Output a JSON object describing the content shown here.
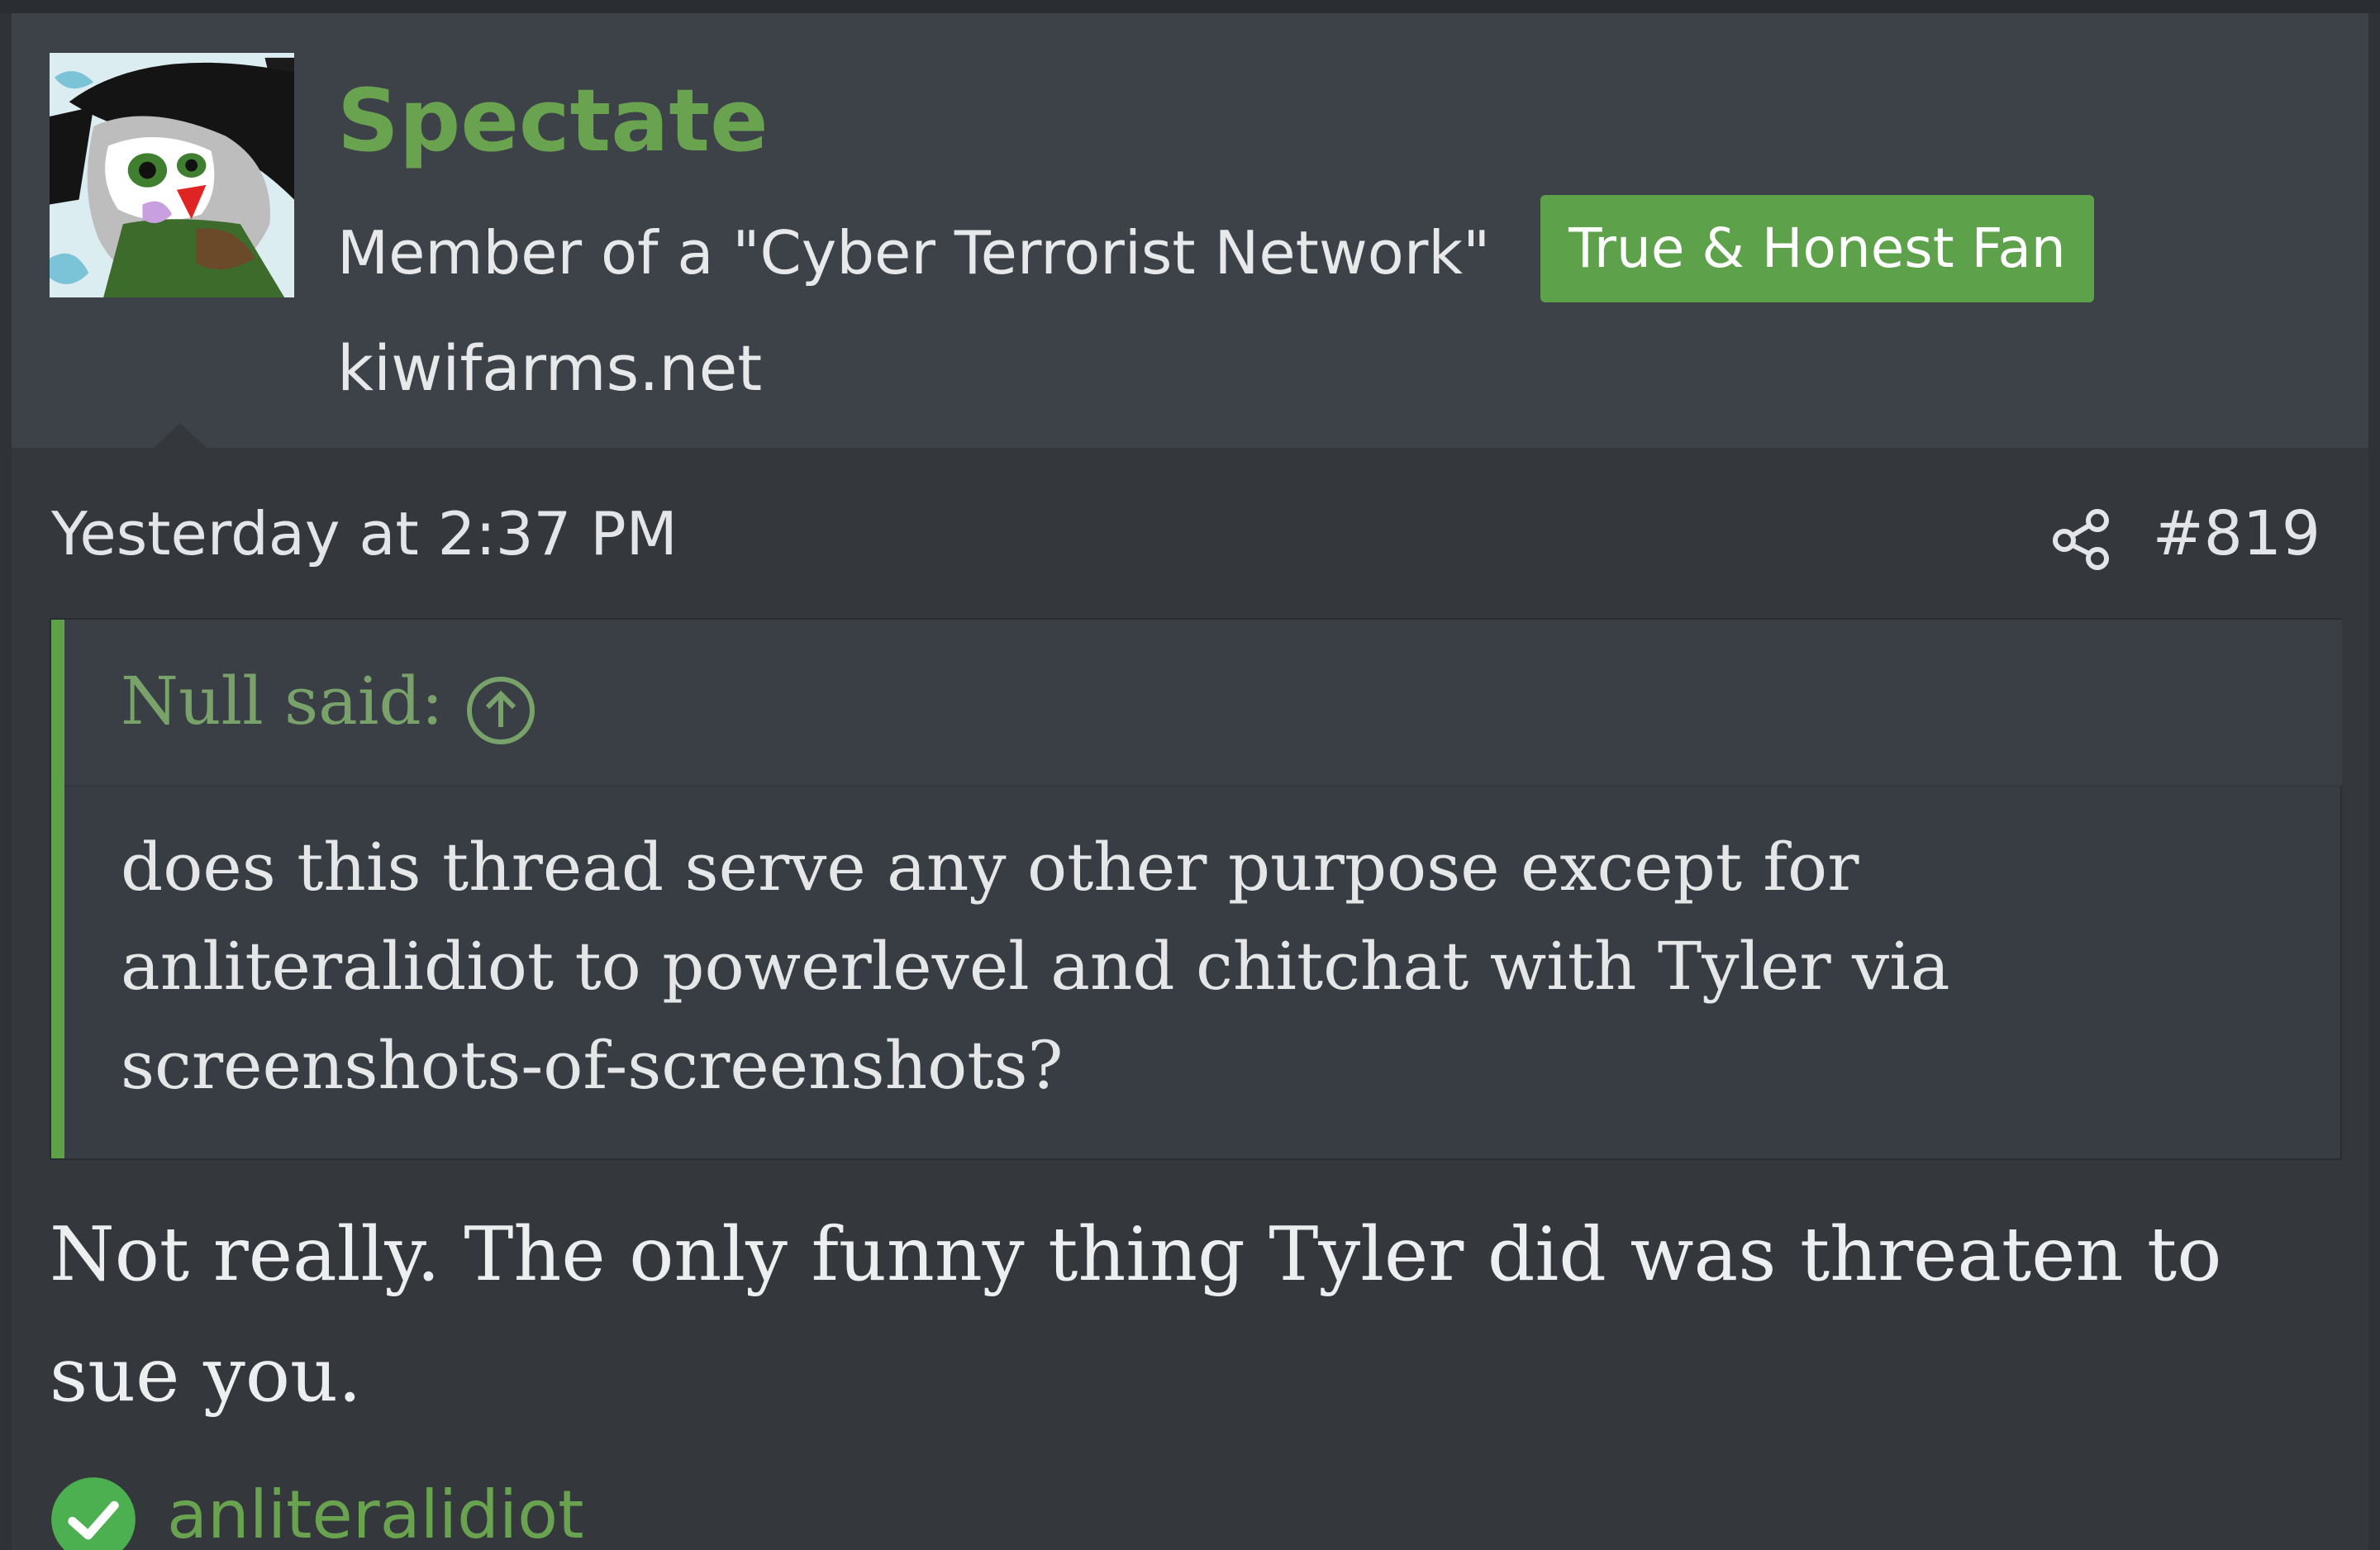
{
  "user": {
    "name": "Spectate",
    "title": "Member of a \"Cyber Terrorist Network\"",
    "banner": "True & Honest Fan",
    "site": "kiwifarms.net",
    "avatar_icon": "cartoon-avatar"
  },
  "post": {
    "date": "Yesterday at 2:37 PM",
    "share_icon": "share-icon",
    "number": "#819"
  },
  "quote": {
    "author": "Null said:",
    "jump_icon": "arrow-up-circle-icon",
    "text": "does this thread serve any other purpose except for anliteralidiot to powerlevel and chitchat with Tyler via screenshots-of-screenshots?"
  },
  "message": {
    "text": "Not really. The only funny thing Tyler did was threaten to sue you."
  },
  "reaction": {
    "icon": "checkmark-circle-icon",
    "user": "anliteralidiot"
  },
  "colors": {
    "accent_green": "#5ea14b",
    "username_green": "#6aa34f",
    "quote_author_green": "#79a26a",
    "header_bg": "#3d4249",
    "body_bg": "#34383d"
  }
}
